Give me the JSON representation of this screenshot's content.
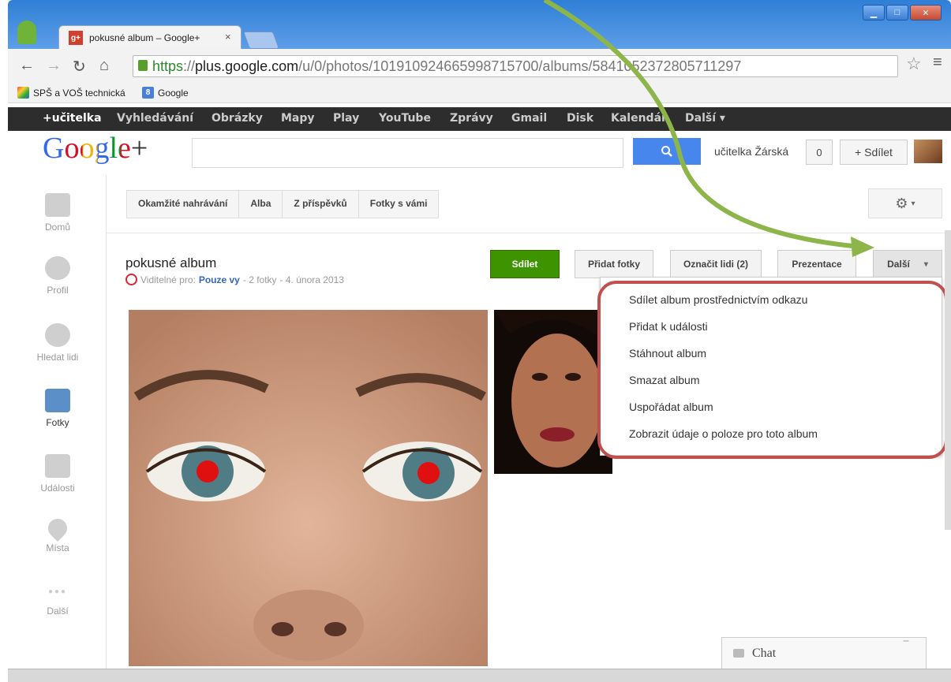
{
  "browser": {
    "tab_title": "pokusné album – Google+",
    "tab_close": "×",
    "favicon": "g+",
    "url_scheme": "https",
    "url_host": "plus.google.com",
    "url_path": "/u/0/photos/101910924665998715700/albums/5841052372805711297",
    "bookmarks": [
      {
        "label": "SPŠ a VOŠ technická",
        "icon": "school-icon"
      },
      {
        "label": "Google",
        "icon": "google-icon",
        "glyph": "8"
      }
    ]
  },
  "gbar": {
    "items": [
      "+učitelka",
      "Vyhledávání",
      "Obrázky",
      "Mapy",
      "Play",
      "YouTube",
      "Zprávy",
      "Gmail",
      "Disk",
      "Kalendář",
      "Další ▾"
    ]
  },
  "header": {
    "logo_text": "Google",
    "logo_plus": "+",
    "search_placeholder": "",
    "user_name": "učitelka Žárská",
    "notification_count": "0",
    "share_label": "+ Sdílet"
  },
  "sidebar": {
    "items": [
      {
        "label": "Domů",
        "icon": "home-icon"
      },
      {
        "label": "Profil",
        "icon": "profile-icon"
      },
      {
        "label": "Hledat lidi",
        "icon": "people-icon"
      },
      {
        "label": "Fotky",
        "icon": "camera-icon",
        "active": true
      },
      {
        "label": "Události",
        "icon": "calendar-icon"
      },
      {
        "label": "Místa",
        "icon": "location-pin-icon"
      },
      {
        "label": "Další",
        "icon": "more-icon",
        "glyph": "●●●"
      }
    ]
  },
  "subtabs": [
    "Okamžité nahrávání",
    "Alba",
    "Z příspěvků",
    "Fotky s vámi"
  ],
  "album": {
    "title": "pokusné album",
    "visibility_prefix": "Viditelné pro:",
    "visibility_who": "Pouze vy",
    "photo_count": "- 2 fotky",
    "date": "- 4. února 2013"
  },
  "actions": {
    "share": "Sdílet",
    "add_photos": "Přidat fotky",
    "tag_people": "Označit lidi (2)",
    "slideshow": "Prezentace",
    "more": "Další"
  },
  "dropdown": [
    "Sdílet album prostřednictvím odkazu",
    "Přidat k události",
    "Stáhnout album",
    "Smazat album",
    "Uspořádat album",
    "Zobrazit údaje o poloze pro toto album"
  ],
  "chat": {
    "label": "Chat",
    "minimize": "‾"
  },
  "colors": {
    "share_green": "#3d9400",
    "search_blue": "#4787ed",
    "annotation_red": "#c0504d",
    "annotation_arrow": "#8db54a"
  }
}
